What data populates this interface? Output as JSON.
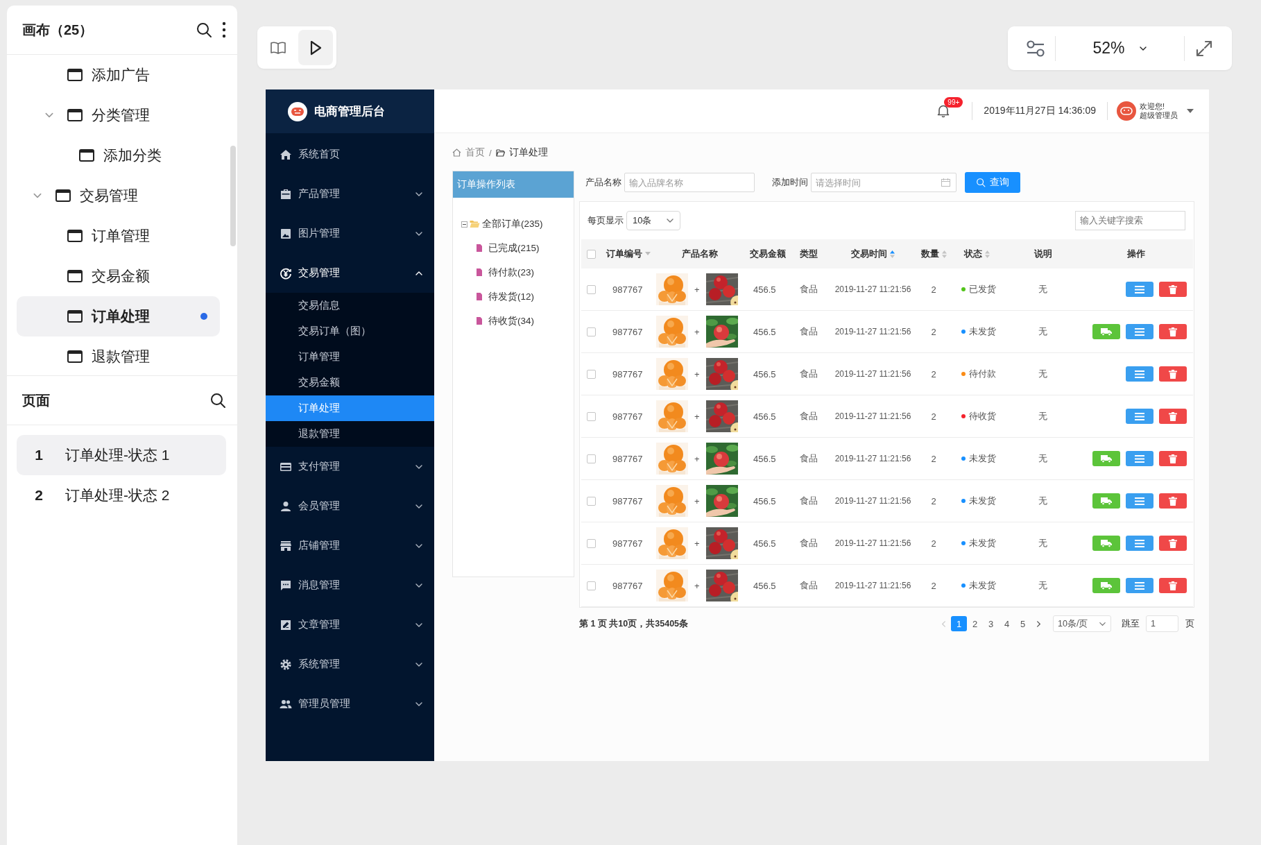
{
  "canvas_panel": {
    "title": "画布（25）",
    "tree": [
      {
        "children": [
          {
            "label": "添加广告",
            "selected": false
          },
          {
            "label": "分类管理",
            "expanded": true,
            "selected": false,
            "children": [
              {
                "label": "添加分类",
                "selected": false
              }
            ]
          }
        ]
      },
      {
        "label": "交易管理",
        "expanded": true,
        "selected": false,
        "children": [
          {
            "label": "订单管理",
            "selected": false
          },
          {
            "label": "交易金额",
            "selected": false
          },
          {
            "label": "订单处理",
            "selected": true
          },
          {
            "label": "退款管理",
            "selected": false
          }
        ]
      }
    ]
  },
  "pages_panel": {
    "title": "页面",
    "pages": [
      {
        "number": "1",
        "label": "订单处理-状态 1",
        "selected": true
      },
      {
        "number": "2",
        "label": "订单处理-状态 2",
        "selected": false
      }
    ]
  },
  "toolbar": {
    "tools": [
      {
        "kind": "book",
        "selected": false
      },
      {
        "kind": "play",
        "selected": true
      }
    ]
  },
  "view_controls": {
    "zoom": "52%"
  },
  "app": {
    "logo_title": "电商管理后台",
    "menu": [
      {
        "label": "系统首页"
      },
      {
        "label": "产品管理",
        "expanded": false
      },
      {
        "label": "图片管理",
        "expanded": false
      },
      {
        "label": "交易管理",
        "expanded": true,
        "children": [
          {
            "label": "交易信息",
            "selected": false
          },
          {
            "label": "交易订单（图）",
            "selected": false
          },
          {
            "label": "订单管理",
            "selected": false
          },
          {
            "label": "交易金额",
            "selected": false
          },
          {
            "label": "订单处理",
            "selected": true
          },
          {
            "label": "退款管理",
            "selected": false
          }
        ]
      },
      {
        "label": "支付管理",
        "expanded": false
      },
      {
        "label": "会员管理",
        "expanded": false
      },
      {
        "label": "店铺管理",
        "expanded": false
      },
      {
        "label": "消息管理",
        "expanded": false
      },
      {
        "label": "文章管理",
        "expanded": false
      },
      {
        "label": "系统管理",
        "expanded": false
      },
      {
        "label": "管理员管理",
        "expanded": false
      }
    ],
    "header": {
      "notification_badge": "99+",
      "datetime": "2019年11月27日 14:36:09",
      "greeting": "欢迎您!",
      "user": "超级管理员"
    },
    "breadcrumb": {
      "items": [
        "首页",
        "订单处理"
      ],
      "separator": "/"
    },
    "order_tree": {
      "title": "订单操作列表",
      "root": {
        "label": "全部订单(235)",
        "expanded": true,
        "children": [
          {
            "label": "已完成(215)"
          },
          {
            "label": "待付款(23)"
          },
          {
            "label": "待发货(12)"
          },
          {
            "label": "待收货(34)"
          }
        ]
      }
    },
    "filters": [
      {
        "kind": "text",
        "label": "产品名称",
        "placeholder": "输入品牌名称"
      },
      {
        "kind": "date",
        "label": "添加时间",
        "placeholder": "请选择时间"
      }
    ],
    "query_button": "查询",
    "table_toolbar": {
      "page_size_label": "每页显示",
      "page_size": "10条",
      "search_placeholder": "输入关键字搜索"
    },
    "table": {
      "columns": [
        {
          "kind": "checkbox",
          "checked": false
        },
        {
          "kind": "dropdown",
          "label": "订单编号"
        },
        {
          "kind": "plain",
          "label": "产品名称"
        },
        {
          "kind": "plain",
          "label": "交易金额"
        },
        {
          "kind": "plain",
          "label": "类型"
        },
        {
          "kind": "sortable",
          "label": "交易时间",
          "ascending": true
        },
        {
          "kind": "sortable",
          "label": "数量",
          "ascending": false
        },
        {
          "kind": "sortable",
          "label": "状态",
          "ascending": false
        },
        {
          "kind": "plain",
          "label": "说明"
        },
        {
          "kind": "plain",
          "label": "操作"
        }
      ],
      "rows": [
        {
          "checked": false,
          "order_no": "987767",
          "joiner": "+",
          "amount": "456.5",
          "type": "食品",
          "time": "2019-11-27 11:21:56",
          "quantity": "2",
          "status": "已发货",
          "color": "#52c41a",
          "note": "无",
          "actions": [
            {
              "kind": "detail"
            },
            {
              "kind": "delete"
            }
          ]
        },
        {
          "checked": false,
          "order_no": "987767",
          "joiner": "+",
          "amount": "456.5",
          "type": "食品",
          "time": "2019-11-27 11:21:56",
          "quantity": "2",
          "status": "未发货",
          "color": "#1890ff",
          "note": "无",
          "actions": [
            {
              "kind": "ship"
            },
            {
              "kind": "detail"
            },
            {
              "kind": "delete"
            }
          ]
        },
        {
          "checked": false,
          "order_no": "987767",
          "joiner": "+",
          "amount": "456.5",
          "type": "食品",
          "time": "2019-11-27 11:21:56",
          "quantity": "2",
          "status": "待付款",
          "color": "#fa8c16",
          "note": "无",
          "actions": [
            {
              "kind": "detail"
            },
            {
              "kind": "delete"
            }
          ]
        },
        {
          "checked": false,
          "order_no": "987767",
          "joiner": "+",
          "amount": "456.5",
          "type": "食品",
          "time": "2019-11-27 11:21:56",
          "quantity": "2",
          "status": "待收货",
          "color": "#f5222d",
          "note": "无",
          "actions": [
            {
              "kind": "detail"
            },
            {
              "kind": "delete"
            }
          ]
        },
        {
          "checked": false,
          "order_no": "987767",
          "joiner": "+",
          "amount": "456.5",
          "type": "食品",
          "time": "2019-11-27 11:21:56",
          "quantity": "2",
          "status": "未发货",
          "color": "#1890ff",
          "note": "无",
          "actions": [
            {
              "kind": "ship"
            },
            {
              "kind": "detail"
            },
            {
              "kind": "delete"
            }
          ]
        },
        {
          "checked": false,
          "order_no": "987767",
          "joiner": "+",
          "amount": "456.5",
          "type": "食品",
          "time": "2019-11-27 11:21:56",
          "quantity": "2",
          "status": "未发货",
          "color": "#1890ff",
          "note": "无",
          "actions": [
            {
              "kind": "ship"
            },
            {
              "kind": "detail"
            },
            {
              "kind": "delete"
            }
          ]
        },
        {
          "checked": false,
          "order_no": "987767",
          "joiner": "+",
          "amount": "456.5",
          "type": "食品",
          "time": "2019-11-27 11:21:56",
          "quantity": "2",
          "status": "未发货",
          "color": "#1890ff",
          "note": "无",
          "actions": [
            {
              "kind": "ship"
            },
            {
              "kind": "detail"
            },
            {
              "kind": "delete"
            }
          ]
        },
        {
          "checked": false,
          "order_no": "987767",
          "joiner": "+",
          "amount": "456.5",
          "type": "食品",
          "time": "2019-11-27 11:21:56",
          "quantity": "2",
          "status": "未发货",
          "color": "#1890ff",
          "note": "无",
          "actions": [
            {
              "kind": "ship"
            },
            {
              "kind": "detail"
            },
            {
              "kind": "delete"
            }
          ]
        }
      ]
    },
    "pagination": {
      "summary": "第 1 页 共10页，共35405条",
      "prev_disabled": true,
      "next_disabled": false,
      "pages": [
        {
          "label": "1",
          "selected": true
        },
        {
          "label": "2",
          "selected": false
        },
        {
          "label": "3",
          "selected": false
        },
        {
          "label": "4",
          "selected": false
        },
        {
          "label": "5",
          "selected": false
        }
      ],
      "page_size": "10条/页",
      "jump_label": "跳至",
      "jump_value": "1",
      "page_suffix": "页"
    }
  }
}
